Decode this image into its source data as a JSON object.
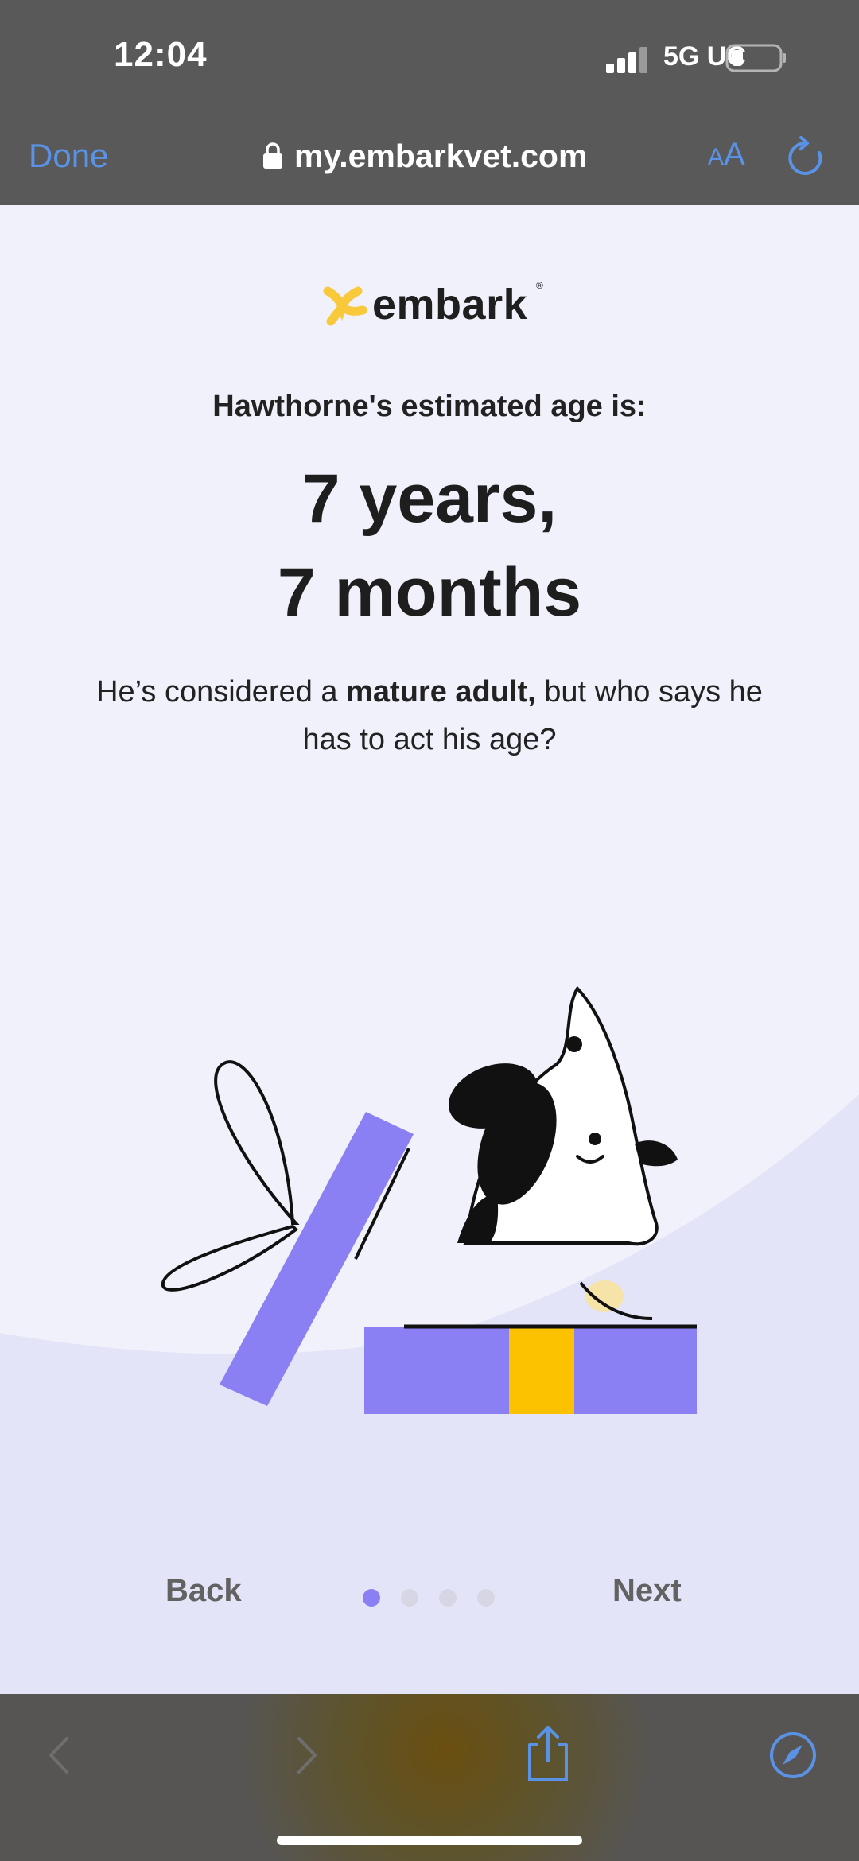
{
  "status_bar": {
    "time": "12:04",
    "network": "5G UC"
  },
  "browser": {
    "done_label": "Done",
    "url": "my.embarkvet.com",
    "text_size_small": "A",
    "text_size_large": "A"
  },
  "brand": {
    "name": "embark",
    "registered": "®"
  },
  "main": {
    "subtitle": "Hawthorne's estimated age is:",
    "age_line1": "7 years,",
    "age_line2": "7 months",
    "desc_before": "He’s considered a ",
    "desc_bold": "mature adult,",
    "desc_after": " but who says he has to act his age?"
  },
  "nav": {
    "back_label": "Back",
    "next_label": "Next",
    "pages": 4,
    "current_page": 1
  },
  "colors": {
    "accent_blue": "#5a93e6",
    "gift_purple": "#8b80f3",
    "ribbon_yellow": "#fcc200",
    "logo_yellow": "#f8c93a"
  },
  "icons": {
    "lock": "lock-icon",
    "reload": "reload-icon",
    "back": "chevron-left-icon",
    "forward": "chevron-right-icon",
    "share": "share-icon",
    "compass": "compass-icon"
  }
}
